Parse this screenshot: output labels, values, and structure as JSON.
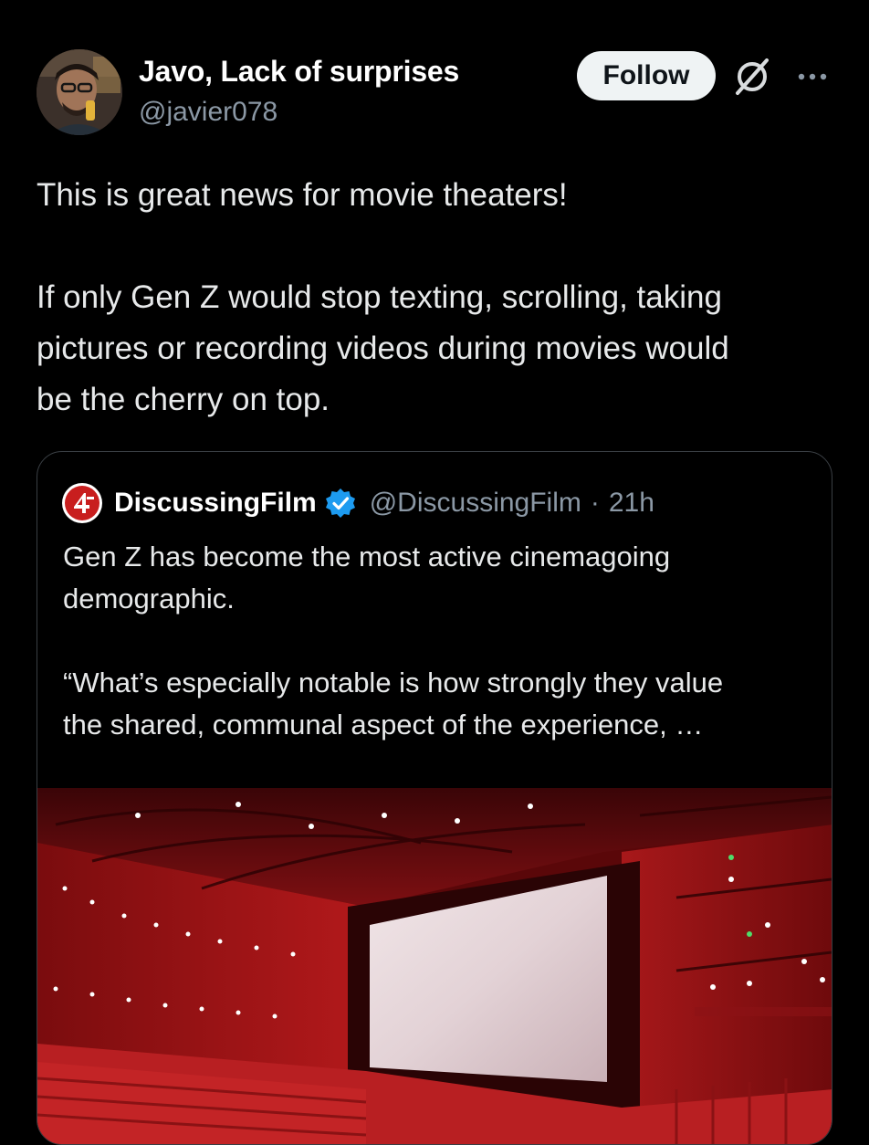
{
  "post": {
    "author_name": "Javo, Lack of surprises",
    "author_handle": "@javier078",
    "follow_label": "Follow",
    "text_paragraph_1": "This is great news for movie theaters!",
    "text_paragraph_2_lines": [
      "If only Gen Z would stop texting, scrolling, taking",
      "pictures or recording videos during movies would",
      "be the cherry on top."
    ]
  },
  "quoted_post": {
    "author_name": "DiscussingFilm",
    "author_handle": "@DiscussingFilm",
    "separator": "·",
    "timestamp": "21h",
    "verified": true,
    "text_paragraph_1_lines": [
      "Gen Z has become the most active cinemagoing",
      "demographic."
    ],
    "text_paragraph_2_lines": [
      "“What’s especially notable is how strongly they value",
      "the shared, communal aspect of the experience, …"
    ]
  },
  "icons": {
    "grok": "grok-icon",
    "more": "more-dots-icon",
    "verified": "verified-badge-icon",
    "logo": "discussingfilm-logo"
  },
  "colors": {
    "background": "#000000",
    "text_primary": "#e7e9ea",
    "text_secondary": "#8b98a5",
    "verified_blue": "#1d9bf0",
    "logo_red": "#c81e1e",
    "follow_button_bg": "#eff3f4"
  }
}
